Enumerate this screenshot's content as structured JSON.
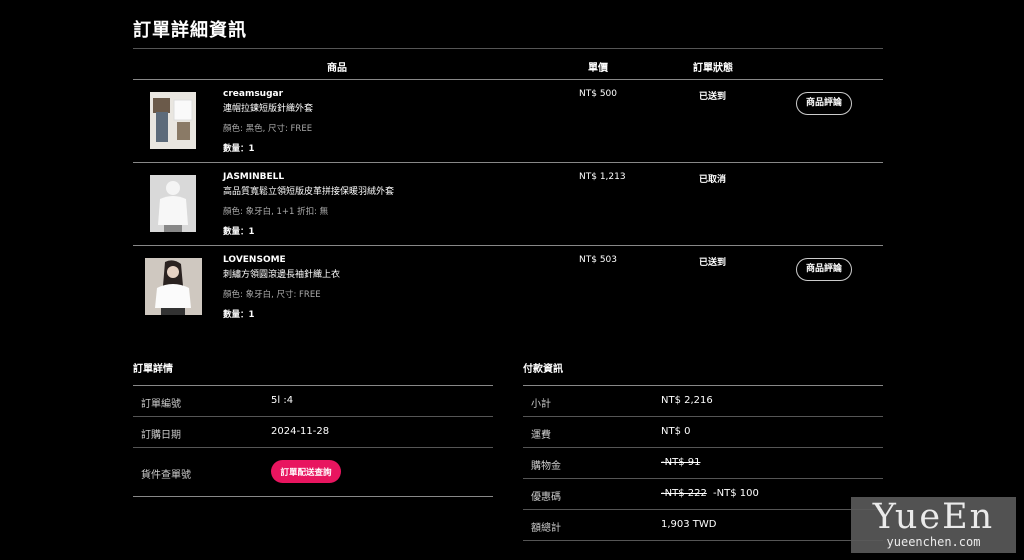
{
  "page_title": "訂單詳細資訊",
  "order_table": {
    "headers": {
      "product": "商品",
      "unit_price": "單價",
      "status": "訂單狀態"
    },
    "items": [
      {
        "brand": "creamsugar",
        "name": "連帽拉鍊短版針織外套",
        "variant": "顏色: 黑色, 尺寸: FREE",
        "quantity": "數量：1",
        "price": "NT$ 500",
        "status": "已送到",
        "review_label": "商品評論"
      },
      {
        "brand": "JASMINBELL",
        "name": "高品質寬鬆立領短版皮革拼接保暖羽絨外套",
        "variant": "顏色: 象牙白, 1+1 折扣: 無",
        "quantity": "數量：1",
        "price": "NT$ 1,213",
        "status": "已取消"
      },
      {
        "brand": "LOVENSOME",
        "name": "刺繡方領圓滾邊長袖針織上衣",
        "variant": "顏色: 象牙白, 尺寸: FREE",
        "quantity": "數量：1",
        "price": "NT$ 503",
        "status": "已送到",
        "review_label": "商品評論"
      }
    ]
  },
  "order_details": {
    "title": "訂單詳情",
    "order_number_label": "訂單編號",
    "order_number_value": "5l :4",
    "order_date_label": "訂購日期",
    "order_date_value": "2024-11-28",
    "tracking_label": "貨件查單號",
    "tracking_button": "訂單配送查詢"
  },
  "payment_info": {
    "title": "付款資訊",
    "subtotal_label": "小計",
    "subtotal_value": "NT$ 2,216",
    "shipping_label": "運費",
    "shipping_value": "NT$ 0",
    "shopping_credit_label": "購物金",
    "shopping_credit_value": "-NT$ 91",
    "coupon_label": "優惠碼",
    "coupon_original": "-NT$ 222",
    "coupon_value": "-NT$ 100",
    "total_label": "額總計",
    "total_value": "1,903 TWD"
  },
  "watermark": {
    "main": "YueEn",
    "sub": "yueenchen.com"
  },
  "colors": {
    "background": "#000000",
    "accent": "#e8155f",
    "text": "#ffffff",
    "muted": "#aaaaaa"
  }
}
